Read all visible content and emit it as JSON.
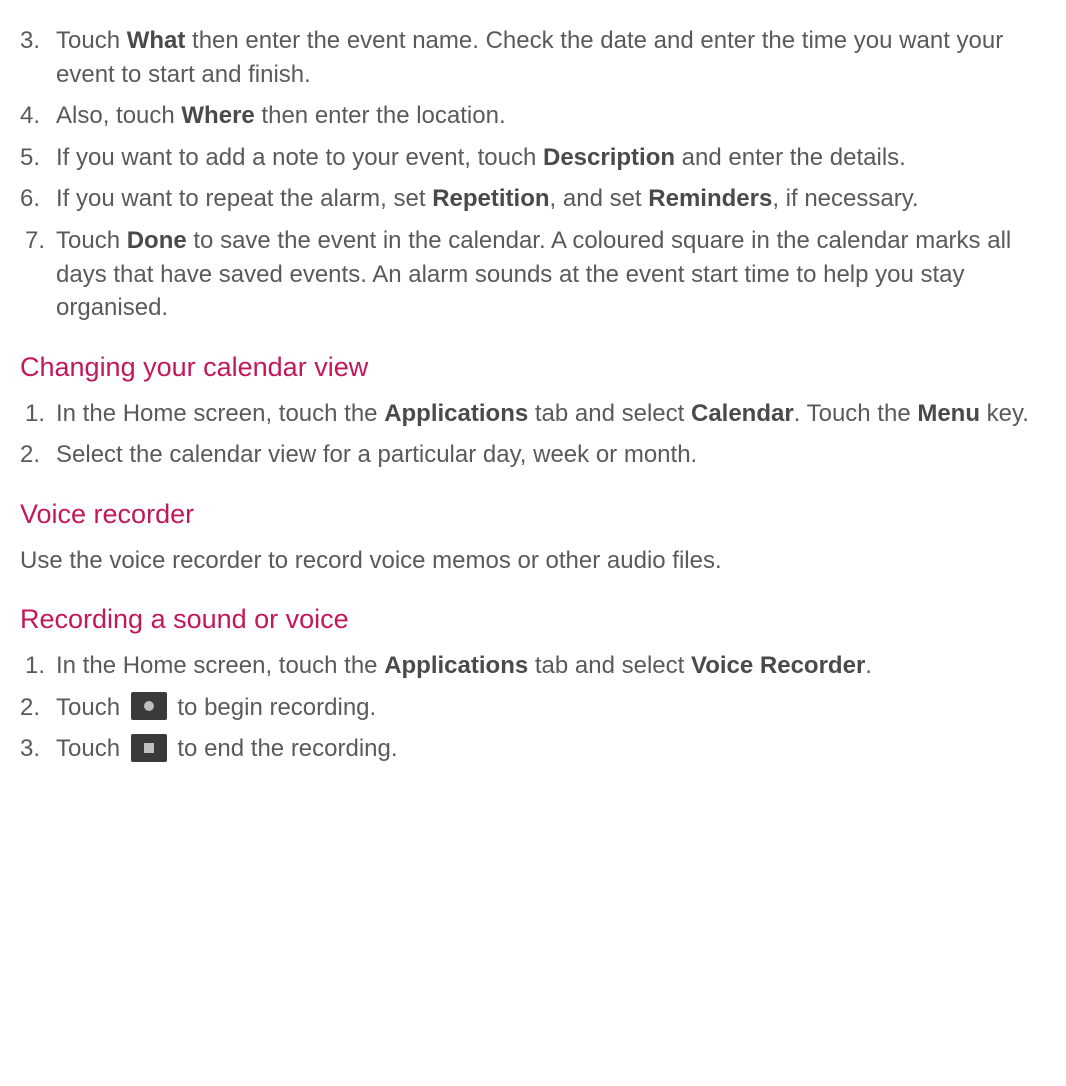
{
  "list1": {
    "i3": {
      "num": "3.",
      "pre": "Touch ",
      "b1": "What",
      "post": " then enter the event name. Check the date and enter the time you want your event to start and finish."
    },
    "i4": {
      "num": "4.",
      "pre": "Also, touch ",
      "b1": "Where",
      "post": " then enter the location."
    },
    "i5": {
      "num": "5.",
      "pre": "If you want to add a note to your event, touch ",
      "b1": "Description",
      "post": " and enter the details."
    },
    "i6": {
      "num": "6.",
      "pre": "If you want to repeat the alarm, set ",
      "b1": "Repetition",
      "mid": ", and set ",
      "b2": "Reminders",
      "post": ", if necessary."
    },
    "i7": {
      "num": "7.",
      "pre": "Touch ",
      "b1": "Done",
      "post": " to save the event in the calendar. A coloured square in the calendar marks all days that have saved events. An alarm sounds at the event start time to help you stay organised."
    }
  },
  "headings": {
    "h1": "Changing your calendar view",
    "h2": "Voice recorder",
    "h3": "Recording a sound or voice"
  },
  "list2": {
    "i1": {
      "num": "1.",
      "pre": "In the Home screen, touch the ",
      "b1": "Applications",
      "mid": " tab and select ",
      "b2": "Calendar",
      "post": ". Touch the ",
      "b3": "Menu",
      "tail": " key."
    },
    "i2": {
      "num": "2.",
      "text": "Select the calendar view for a particular day, week or month."
    }
  },
  "para1": "Use the voice recorder to record voice memos or other audio files.",
  "list3": {
    "i1": {
      "num": "1.",
      "pre": "In the Home screen, touch the ",
      "b1": "Applications",
      "mid": " tab and select ",
      "b2": "Voice Recorder",
      "post": "."
    },
    "i2": {
      "num": "2.",
      "pre": "Touch ",
      "post": " to begin recording."
    },
    "i3": {
      "num": "3.",
      "pre": "Touch ",
      "post": " to end the recording."
    }
  }
}
